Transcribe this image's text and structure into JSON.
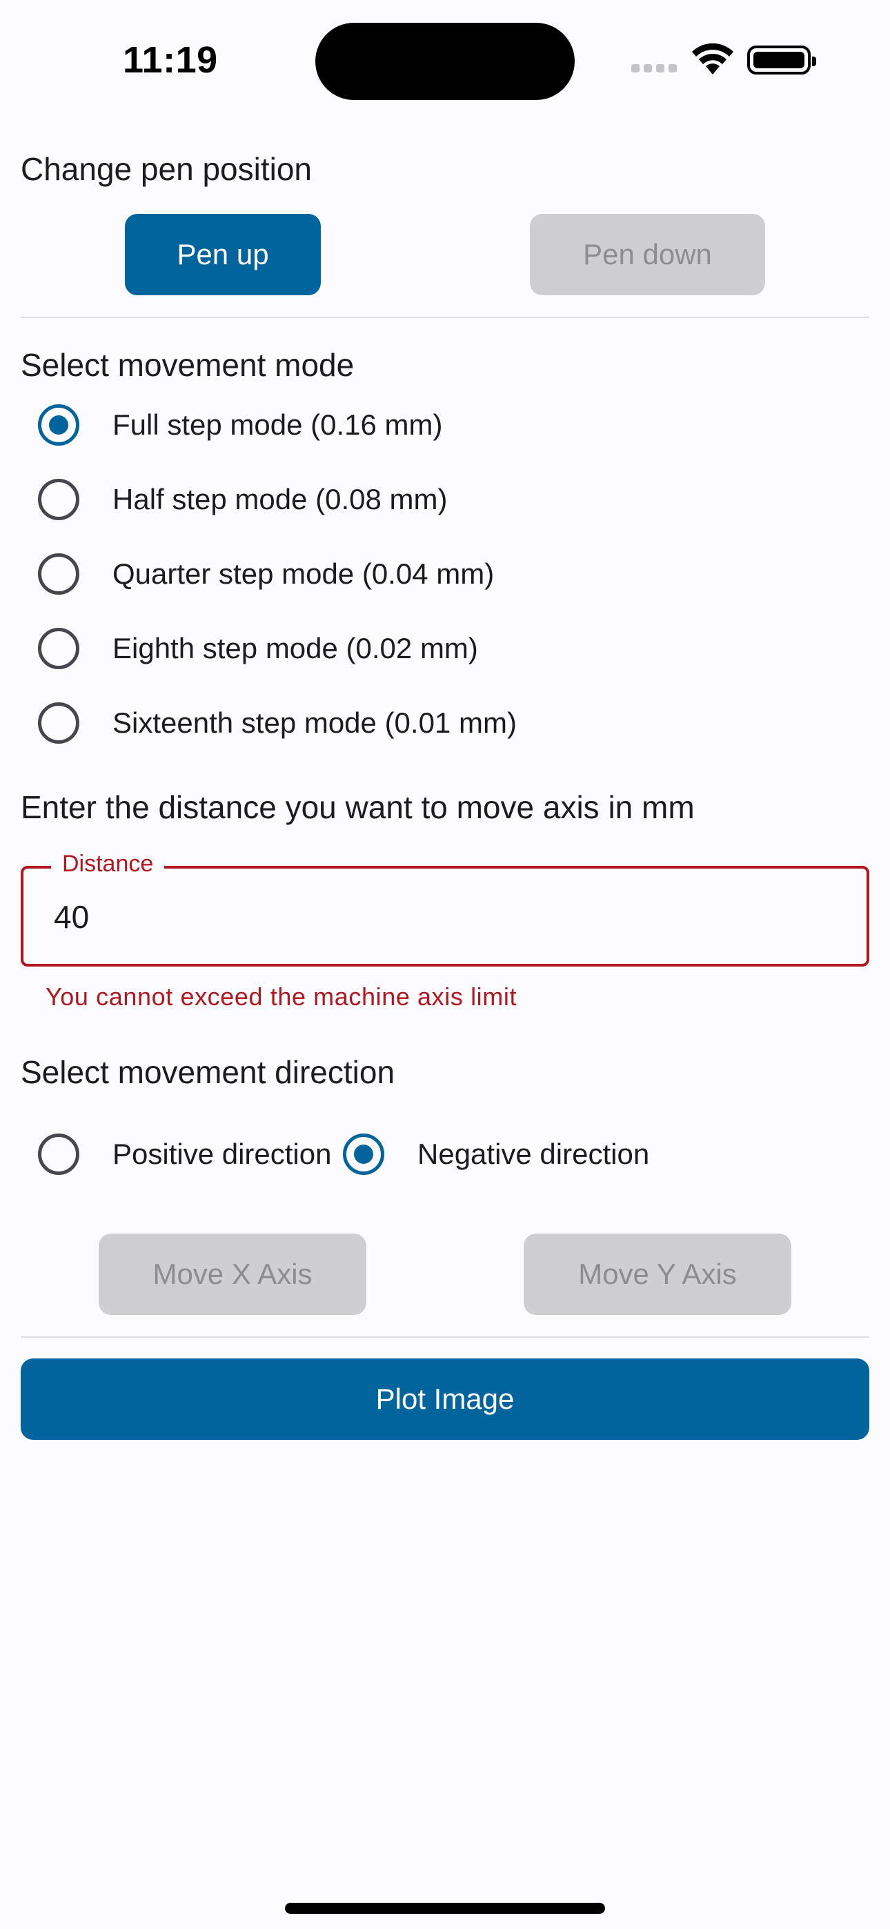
{
  "status_bar": {
    "time": "11:19"
  },
  "pen_section": {
    "title": "Change pen position",
    "pen_up_label": "Pen up",
    "pen_down_label": "Pen down"
  },
  "movement_mode": {
    "title": "Select movement mode",
    "options": [
      {
        "label": "Full step mode (0.16 mm)",
        "selected": true
      },
      {
        "label": "Half step mode (0.08 mm)",
        "selected": false
      },
      {
        "label": "Quarter step mode (0.04 mm)",
        "selected": false
      },
      {
        "label": "Eighth step mode (0.02 mm)",
        "selected": false
      },
      {
        "label": "Sixteenth step mode (0.01 mm)",
        "selected": false
      }
    ]
  },
  "distance": {
    "title": "Enter the distance you want to move axis in mm",
    "label": "Distance",
    "value": "40",
    "error": "You cannot exceed the machine axis limit"
  },
  "direction": {
    "title": "Select movement direction",
    "positive_label": "Positive direction",
    "negative_label": "Negative direction",
    "selected": "negative"
  },
  "axis_buttons": {
    "move_x_label": "Move X Axis",
    "move_y_label": "Move Y Axis"
  },
  "plot_button": {
    "label": "Plot Image"
  },
  "colors": {
    "primary": "#02649d",
    "error": "#b3161f",
    "disabled_bg": "#cfcfd1",
    "disabled_text": "#8d8d90",
    "background": "#fcfbfe"
  }
}
